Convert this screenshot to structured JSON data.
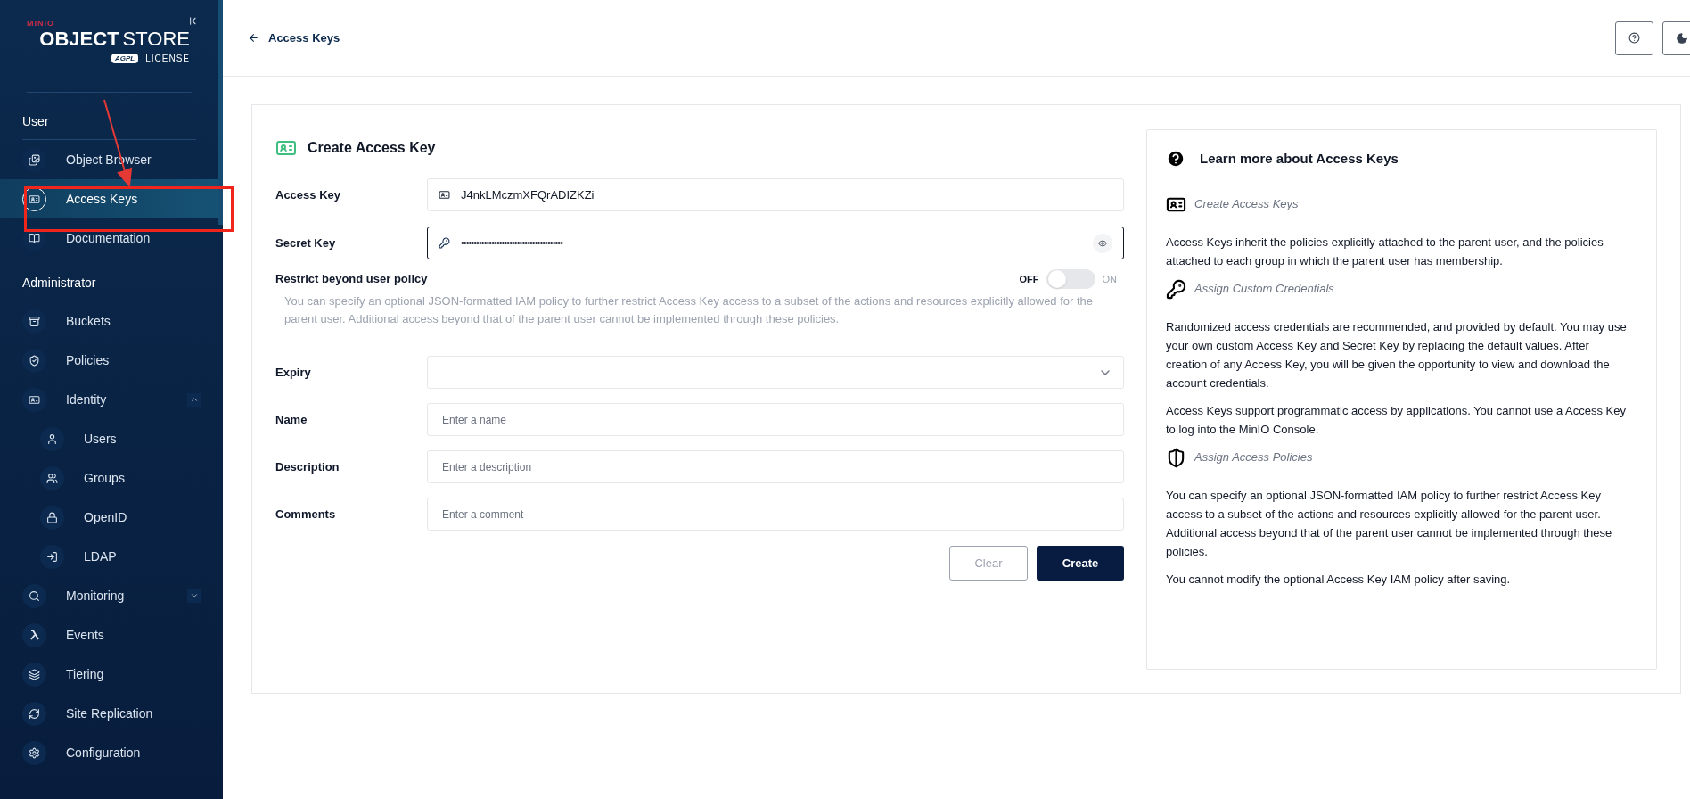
{
  "logo": {
    "brand": "MINIO",
    "product_bold": "OBJECT",
    "product_light": "STORE",
    "badge": "AGPL",
    "license": "LICENSE"
  },
  "sidebar": {
    "sections": [
      {
        "title": "User",
        "items": [
          {
            "label": "Object Browser",
            "selected": false
          },
          {
            "label": "Access Keys",
            "selected": true
          },
          {
            "label": "Documentation",
            "selected": false
          }
        ]
      },
      {
        "title": "Administrator",
        "items": [
          {
            "label": "Buckets",
            "selected": false
          },
          {
            "label": "Policies",
            "selected": false
          },
          {
            "label": "Identity",
            "selected": false,
            "expanded": true,
            "children": [
              {
                "label": "Users",
                "selected": false
              },
              {
                "label": "Groups",
                "selected": false
              },
              {
                "label": "OpenID",
                "selected": false
              },
              {
                "label": "LDAP",
                "selected": false
              }
            ]
          },
          {
            "label": "Monitoring",
            "selected": false,
            "expanded": false
          },
          {
            "label": "Events",
            "selected": false
          },
          {
            "label": "Tiering",
            "selected": false
          },
          {
            "label": "Site Replication",
            "selected": false
          },
          {
            "label": "Configuration",
            "selected": false
          }
        ]
      }
    ]
  },
  "header": {
    "back_label": "Access Keys"
  },
  "form": {
    "title": "Create Access Key",
    "access_key": {
      "label": "Access Key",
      "value": "J4nkLMczmXFQrADIZKZi"
    },
    "secret_key": {
      "label": "Secret Key",
      "value": "••••••••••••••••••••••••••••••••••••••••",
      "focused": true
    },
    "restrict": {
      "label": "Restrict beyond user policy",
      "on": false,
      "off_label": "OFF",
      "on_label": "ON",
      "description": "You can specify an optional JSON-formatted IAM policy to further restrict Access Key access to a subset of the actions and resources explicitly allowed for the parent user. Additional access beyond that of the parent user cannot be implemented through these policies."
    },
    "expiry": {
      "label": "Expiry"
    },
    "fields": [
      {
        "label": "Name",
        "placeholder": "Enter a name"
      },
      {
        "label": "Description",
        "placeholder": "Enter a description"
      },
      {
        "label": "Comments",
        "placeholder": "Enter a comment"
      }
    ],
    "buttons": [
      {
        "label": "Clear",
        "kind": "secondary"
      },
      {
        "label": "Create",
        "kind": "primary"
      }
    ]
  },
  "help": {
    "title": "Learn more about Access Keys",
    "sections": [
      {
        "heading": "Create Access Keys",
        "paragraphs": [
          "Access Keys inherit the policies explicitly attached to the parent user, and the policies attached to each group in which the parent user has membership."
        ]
      },
      {
        "heading": "Assign Custom Credentials",
        "paragraphs": [
          "Randomized access credentials are recommended, and provided by default. You may use your own custom Access Key and Secret Key by replacing the default values. After creation of any Access Key, you will be given the opportunity to view and download the account credentials.",
          "Access Keys support programmatic access by applications. You cannot use a Access Key to log into the MinIO Console."
        ]
      },
      {
        "heading": "Assign Access Policies",
        "paragraphs": [
          "You can specify an optional JSON-formatted IAM policy to further restrict Access Key access to a subset of the actions and resources explicitly allowed for the parent user. Additional access beyond that of the parent user cannot be implemented through these policies.",
          "You cannot modify the optional Access Key IAM policy after saving."
        ]
      }
    ]
  }
}
